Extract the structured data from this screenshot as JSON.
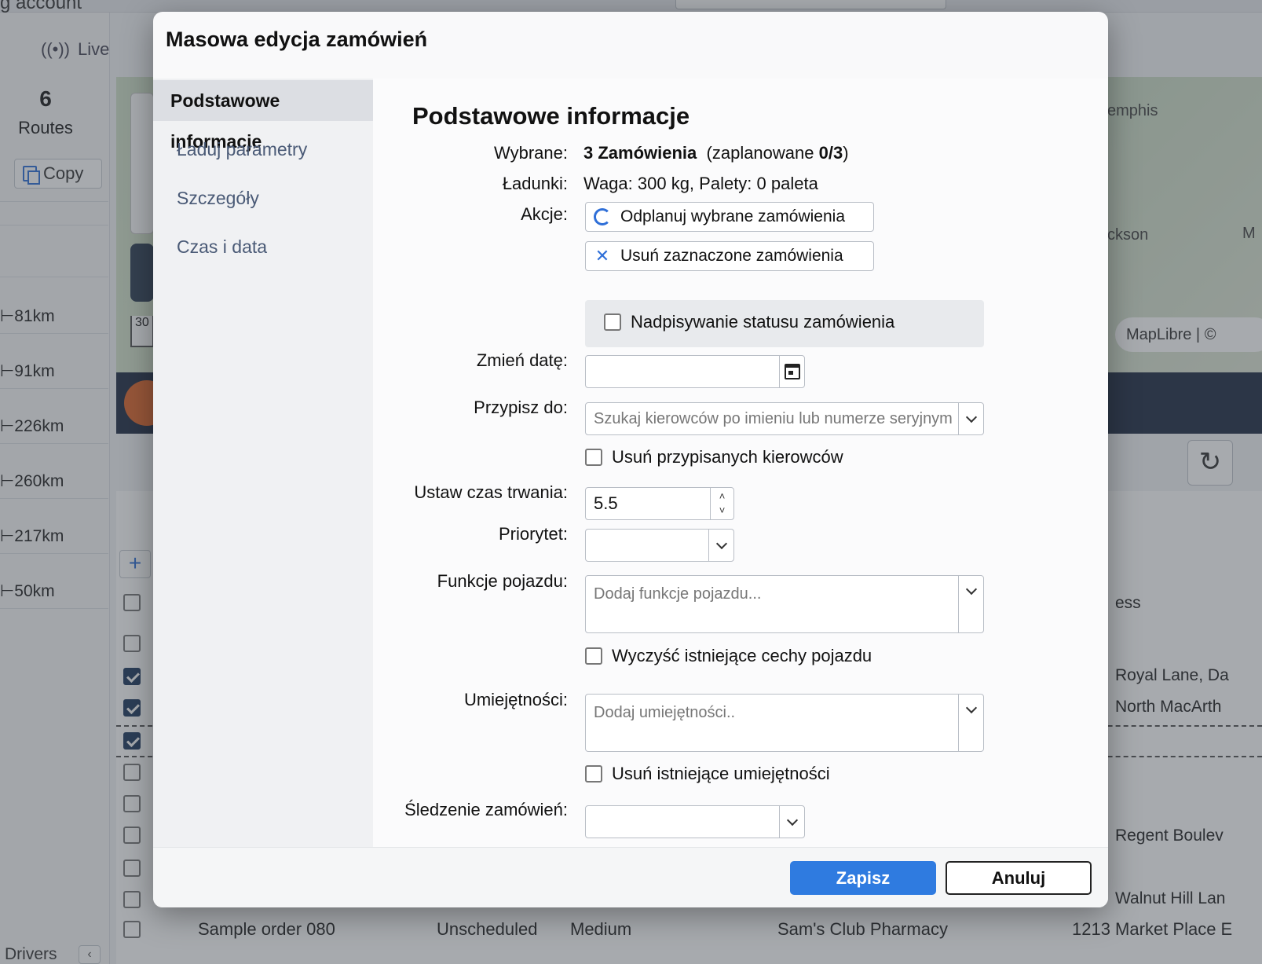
{
  "background": {
    "account_fragment": "g account",
    "live_label": "Live",
    "routes_count": "6",
    "routes_label": "Routes",
    "copy_label": "Copy",
    "distances": [
      "81km",
      "91km",
      "226km",
      "260km",
      "217km",
      "50km"
    ],
    "map_cities": [
      "emphis",
      "ckson",
      "M"
    ],
    "map_scale": "30",
    "map_attribution": "MapLibre | ©",
    "column_fragment": "ess",
    "addresses": [
      "Royal Lane, Da",
      "North MacArth",
      "Regent Boulev",
      "Walnut Hill Lan"
    ],
    "drivers_label": "Drivers",
    "last_row": {
      "order": "Sample order 080",
      "status": "Unscheduled",
      "priority": "Medium",
      "customer": "Sam's Club Pharmacy",
      "address": "1213 Market Place E"
    }
  },
  "modal": {
    "title": "Masowa edycja zamówień",
    "nav": [
      {
        "label": "Podstawowe informacje",
        "active": true
      },
      {
        "label": "Ładuj parametry",
        "active": false
      },
      {
        "label": "Szczegóły",
        "active": false
      },
      {
        "label": "Czas i data",
        "active": false
      }
    ],
    "section_title": "Podstawowe informacje",
    "selected_label": "Wybrane:",
    "selected_value": "3 Zamówienia",
    "scheduled_prefix": "(zaplanowane",
    "scheduled_value": "0/3",
    "scheduled_suffix": ")",
    "loads_label": "Ładunki:",
    "loads_value": "Waga: 300 kg, Palety: 0 paleta",
    "actions_label": "Akcje:",
    "unschedule_label": "Odplanuj wybrane zamówienia",
    "delete_label": "Usuń zaznaczone zamówienia",
    "override_status_label": "Nadpisywanie statusu zamówienia",
    "change_date_label": "Zmień datę:",
    "change_date_value": "",
    "assign_label": "Przypisz do:",
    "assign_placeholder": "Szukaj kierowców po imieniu lub numerze seryjnym",
    "remove_drivers_label": "Usuń przypisanych kierowców",
    "duration_label": "Ustaw czas trwania:",
    "duration_value": "5.5",
    "priority_label": "Priorytet:",
    "priority_value": "",
    "vehicle_features_label": "Funkcje pojazdu:",
    "vehicle_features_placeholder": "Dodaj funkcje pojazdu...",
    "clear_features_label": "Wyczyść istniejące cechy pojazdu",
    "skills_label": "Umiejętności:",
    "skills_placeholder": "Dodaj umiejętności..",
    "remove_skills_label": "Usuń istniejące umiejętności",
    "tracking_label": "Śledzenie zamówień:",
    "tracking_value": "",
    "save_label": "Zapisz",
    "cancel_label": "Anuluj",
    "accent_color": "#2f7be0"
  }
}
